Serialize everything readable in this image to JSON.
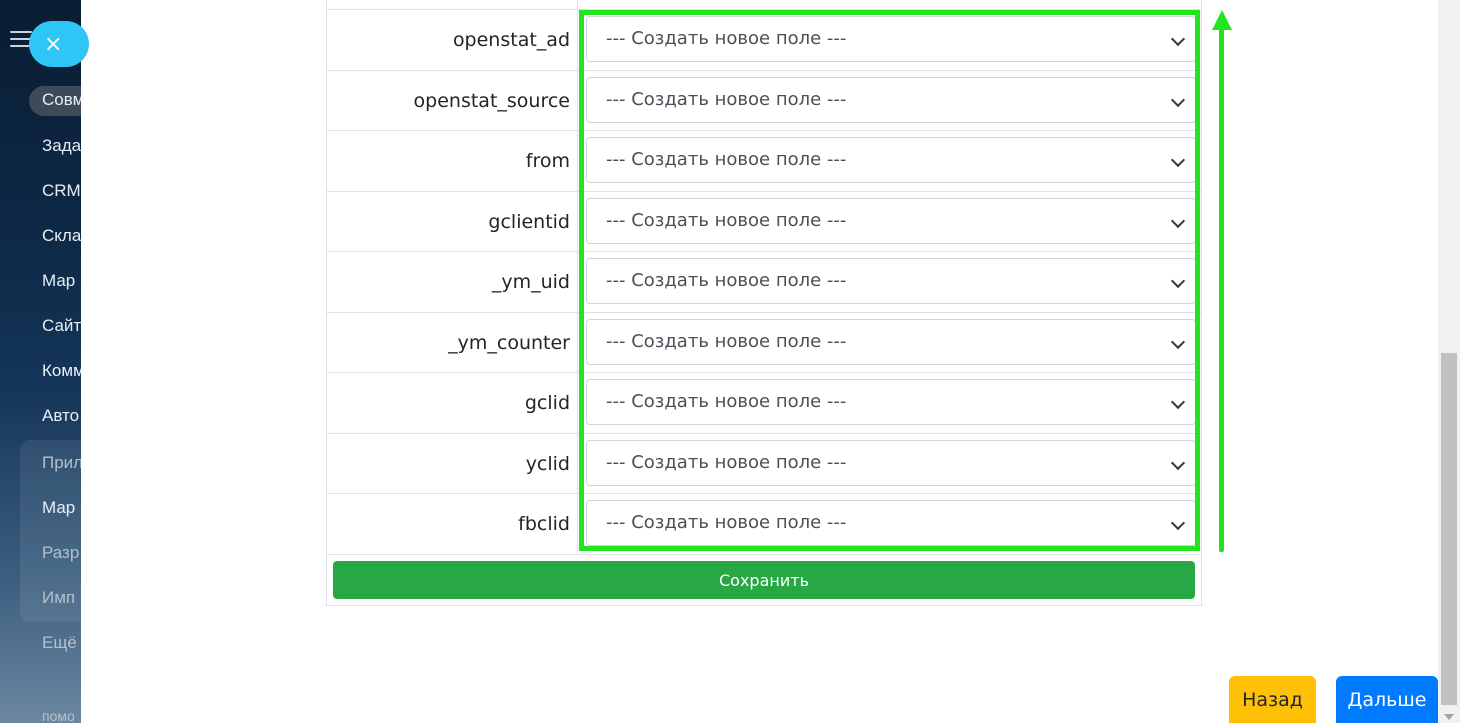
{
  "sidebar": {
    "items": [
      {
        "label": "Совм"
      },
      {
        "label": "Зада"
      },
      {
        "label": "CRM"
      },
      {
        "label": "Скла"
      },
      {
        "label": "Мар"
      },
      {
        "label": "Сайт"
      },
      {
        "label": "Комм"
      },
      {
        "label": "Авто"
      },
      {
        "label": "Прил"
      },
      {
        "label": "Мар"
      },
      {
        "label": "Разр"
      },
      {
        "label": "Имп"
      },
      {
        "label": "Ещё"
      },
      {
        "label": "помо"
      }
    ],
    "close_icon": "×"
  },
  "mapping": {
    "rows": [
      {
        "field": "openstat_ad",
        "select_value": "--- Создать новое поле ---"
      },
      {
        "field": "openstat_source",
        "select_value": "--- Создать новое поле ---"
      },
      {
        "field": "from",
        "select_value": "--- Создать новое поле ---"
      },
      {
        "field": "gclientid",
        "select_value": "--- Создать новое поле ---"
      },
      {
        "field": "_ym_uid",
        "select_value": "--- Создать новое поле ---"
      },
      {
        "field": "_ym_counter",
        "select_value": "--- Создать новое поле ---"
      },
      {
        "field": "gclid",
        "select_value": "--- Создать новое поле ---"
      },
      {
        "field": "yclid",
        "select_value": "--- Создать новое поле ---"
      },
      {
        "field": "fbclid",
        "select_value": "--- Создать новое поле ---"
      }
    ],
    "save_label": "Сохранить"
  },
  "footer": {
    "back_label": "Назад",
    "next_label": "Дальше"
  },
  "colors": {
    "highlight": "#22e51f",
    "save": "#28a745",
    "back": "#ffc107",
    "next": "#007bff"
  }
}
